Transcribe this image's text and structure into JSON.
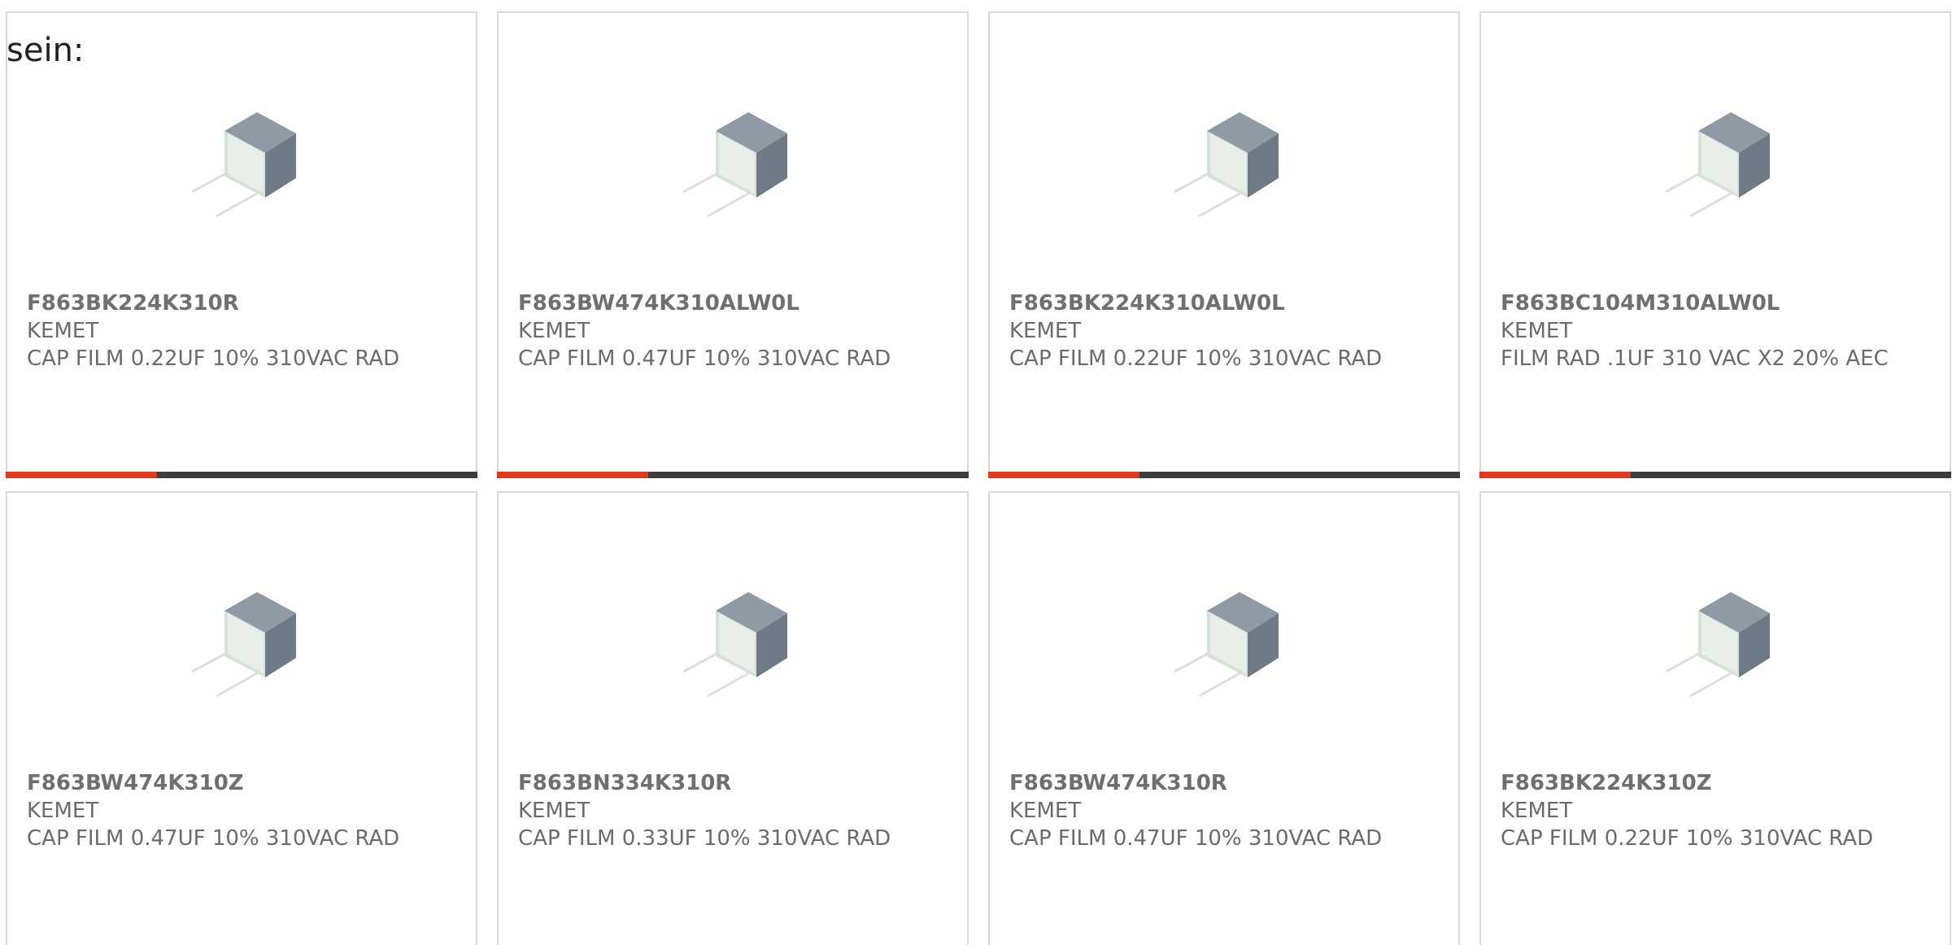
{
  "intro_text": "sein:",
  "colors": {
    "accent": "#e1381b",
    "track": "#3d3d3d",
    "card_border": "#d9d9d9",
    "text": "#6b6b6b"
  },
  "products": [
    {
      "part_number": "F863BK224K310R",
      "manufacturer": "KEMET",
      "description": "CAP FILM 0.22UF 10% 310VAC RAD",
      "image_icon": "film-capacitor-image",
      "progress": 0.32
    },
    {
      "part_number": "F863BW474K310ALW0L",
      "manufacturer": "KEMET",
      "description": "CAP FILM 0.47UF 10% 310VAC RAD",
      "image_icon": "film-capacitor-image",
      "progress": 0.32
    },
    {
      "part_number": "F863BK224K310ALW0L",
      "manufacturer": "KEMET",
      "description": "CAP FILM 0.22UF 10% 310VAC RAD",
      "image_icon": "film-capacitor-image",
      "progress": 0.32
    },
    {
      "part_number": "F863BC104M310ALW0L",
      "manufacturer": "KEMET",
      "description": "FILM RAD .1UF 310 VAC X2 20% AEC",
      "image_icon": "film-capacitor-image",
      "progress": 0.32
    },
    {
      "part_number": "F863BW474K310Z",
      "manufacturer": "KEMET",
      "description": "CAP FILM 0.47UF 10% 310VAC RAD",
      "image_icon": "film-capacitor-image"
    },
    {
      "part_number": "F863BN334K310R",
      "manufacturer": "KEMET",
      "description": "CAP FILM 0.33UF 10% 310VAC RAD",
      "image_icon": "film-capacitor-image"
    },
    {
      "part_number": "F863BW474K310R",
      "manufacturer": "KEMET",
      "description": "CAP FILM 0.47UF 10% 310VAC RAD",
      "image_icon": "film-capacitor-image"
    },
    {
      "part_number": "F863BK224K310Z",
      "manufacturer": "KEMET",
      "description": "CAP FILM 0.22UF 10% 310VAC RAD",
      "image_icon": "film-capacitor-image"
    }
  ]
}
